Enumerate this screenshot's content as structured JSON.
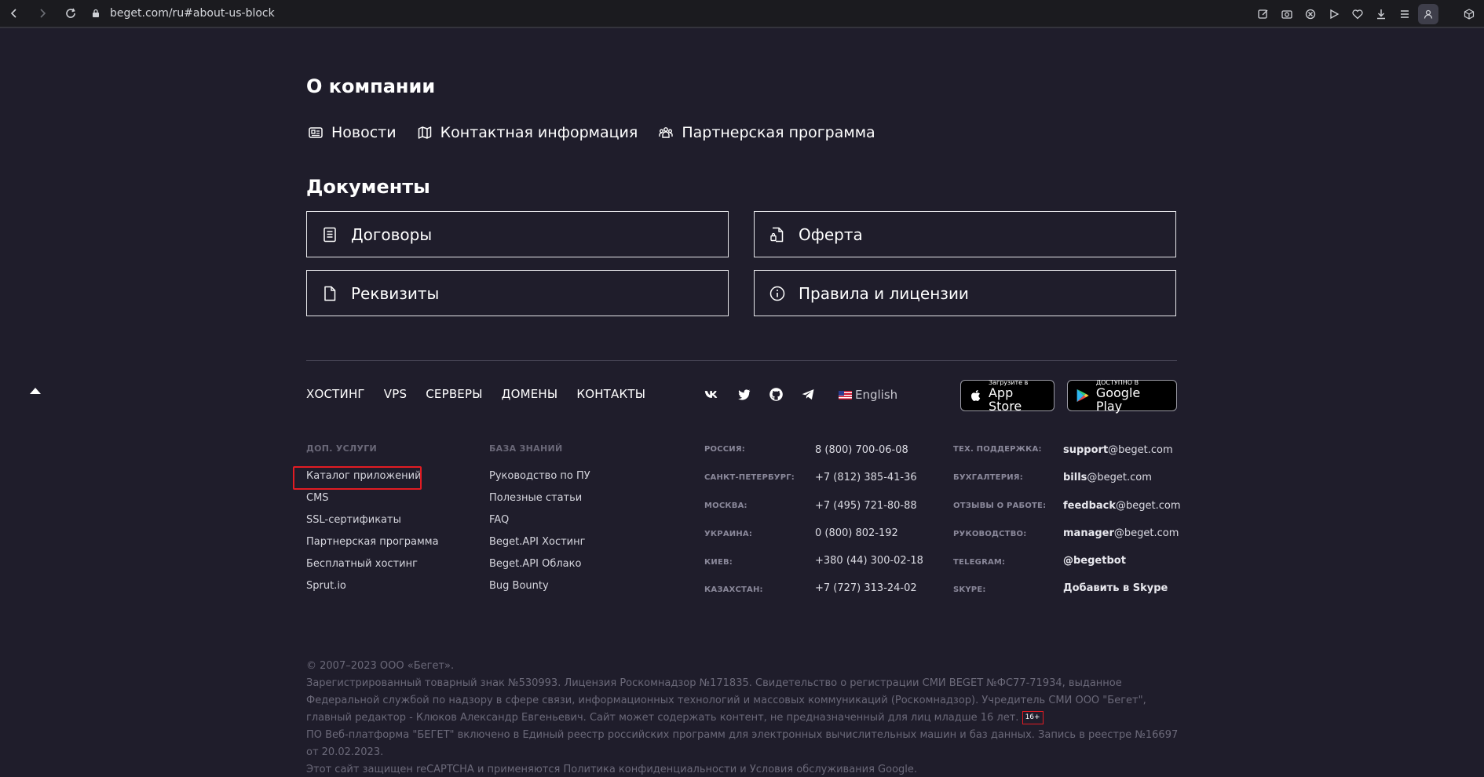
{
  "browser": {
    "url": "beget.com/ru#about-us-block"
  },
  "about": {
    "title": "О компании",
    "links": [
      {
        "label": "Новости",
        "icon": "news-icon"
      },
      {
        "label": "Контактная информация",
        "icon": "map-icon"
      },
      {
        "label": "Партнерская программа",
        "icon": "partners-icon"
      }
    ]
  },
  "documents": {
    "title": "Документы",
    "cards": [
      {
        "label": "Договоры",
        "icon": "contract-icon"
      },
      {
        "label": "Оферта",
        "icon": "offer-icon"
      },
      {
        "label": "Реквизиты",
        "icon": "file-icon"
      },
      {
        "label": "Правила и лицензии",
        "icon": "info-icon"
      }
    ]
  },
  "footer_nav": [
    "ХОСТИНГ",
    "VPS",
    "СЕРВЕРЫ",
    "ДОМЕНЫ",
    "КОНТАКТЫ"
  ],
  "socials": [
    "vk-icon",
    "twitter-icon",
    "github-icon",
    "telegram-icon"
  ],
  "language": "English",
  "stores": {
    "appstore": {
      "small": "Загрузите в",
      "big": "App Store"
    },
    "googleplay": {
      "small": "ДОСТУПНО В",
      "big": "Google Play"
    }
  },
  "services": {
    "heading": "ДОП. УСЛУГИ",
    "items": [
      "Каталог приложений",
      "CMS",
      "SSL-сертификаты",
      "Партнерская программа",
      "Бесплатный хостинг",
      "Sprut.io"
    ]
  },
  "knowledge": {
    "heading": "БАЗА ЗНАНИЙ",
    "items": [
      "Руководство по ПУ",
      "Полезные статьи",
      "FAQ",
      "Beget.API Хостинг",
      "Beget.API Облако",
      "Bug Bounty"
    ]
  },
  "phones": [
    {
      "label": "РОССИЯ:",
      "value": "8 (800) 700-06-08"
    },
    {
      "label": "САНКТ-ПЕТЕРБУРГ:",
      "value": "+7 (812) 385-41-36"
    },
    {
      "label": "МОСКВА:",
      "value": "+7 (495) 721-80-88"
    },
    {
      "label": "УКРАИНА:",
      "value": "0 (800) 802-192"
    },
    {
      "label": "КИЕВ:",
      "value": "+380 (44) 300-02-18"
    },
    {
      "label": "КАЗАХСТАН:",
      "value": "+7 (727) 313-24-02"
    }
  ],
  "support": [
    {
      "label": "ТЕХ. ПОДДЕРЖКА:",
      "bold": "support",
      "rest": "@beget.com"
    },
    {
      "label": "БУХГАЛТЕРИЯ:",
      "bold": "bills",
      "rest": "@beget.com"
    },
    {
      "label": "ОТЗЫВЫ О РАБОТЕ:",
      "bold": "feedback",
      "rest": "@beget.com"
    },
    {
      "label": "РУКОВОДСТВО:",
      "bold": "manager",
      "rest": "@beget.com"
    },
    {
      "label": "TELEGRAM:",
      "bold": "@begetbot",
      "rest": ""
    },
    {
      "label": "SKYPE:",
      "bold": "Добавить в Skype",
      "rest": ""
    }
  ],
  "legal": {
    "line1": "© 2007–2023 ООО «Бегет».",
    "line2": "Зарегистрированный товарный знак №530993. Лицензия Роскомнадзор №171835. Свидетельство о регистрации СМИ BEGET №ФС77-71934, выданное Федеральной службой по надзору в сфере связи, информационных технологий и массовых коммуникаций (Роскомнадзор). Учредитель СМИ ООО \"Бегет\", главный редактор - Клюков Александр Евгеньевич. Сайт может содержать контент, не предназначенный для лиц младше 16 лет.",
    "badge": "16+",
    "line3": "ПО Веб-платформа \"БЕГЕТ\" включено в Единый реестр российских программ для электронных вычислительных машин и баз данных. Запись в реестре №16697 от 20.02.2023.",
    "line4": "Этот сайт защищен reCAPTCHA и применяются Политика конфиденциальности и Условия обслуживания Google."
  }
}
